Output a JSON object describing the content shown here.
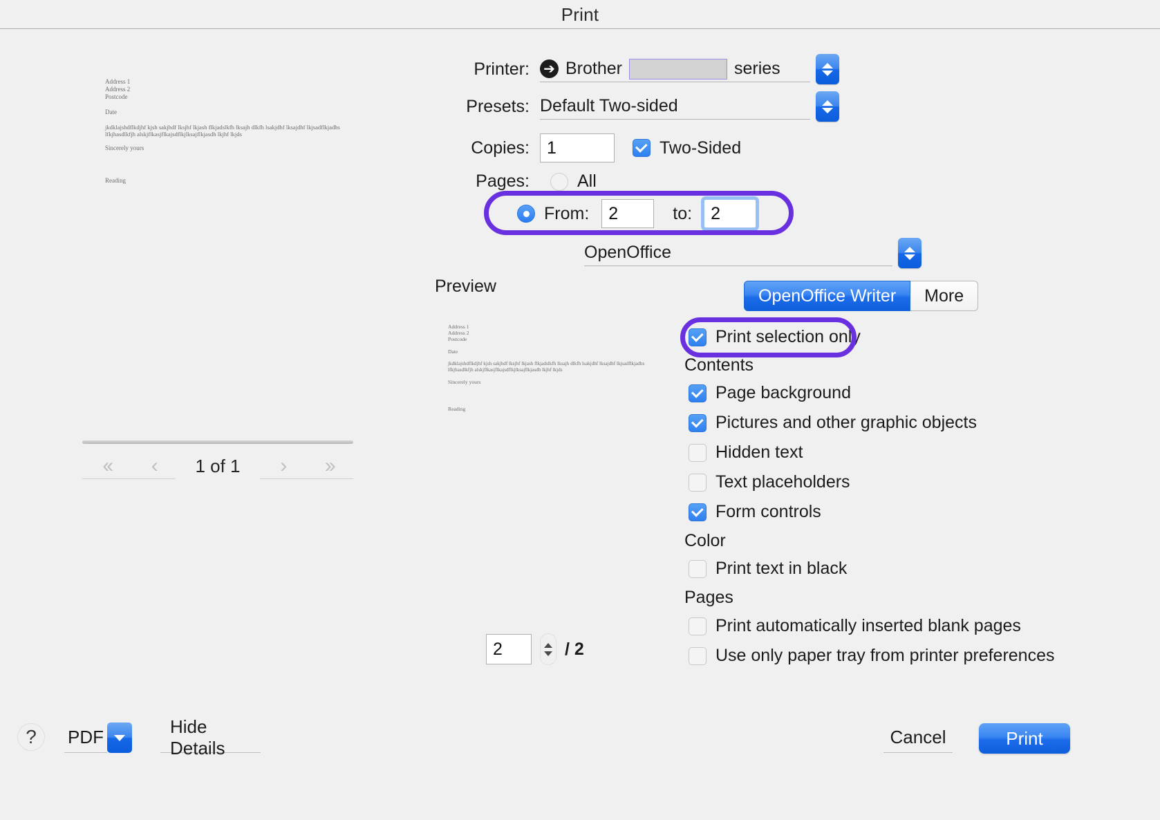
{
  "window": {
    "title": "Print"
  },
  "printer": {
    "label": "Printer:",
    "icon": "brother-status-icon",
    "name_prefix": "Brother",
    "name_suffix": "series",
    "redacted": ""
  },
  "presets": {
    "label": "Presets:",
    "value": "Default Two-sided"
  },
  "copies": {
    "label": "Copies:",
    "value": "1",
    "two_sided_label": "Two-Sided",
    "two_sided_checked": true
  },
  "pages": {
    "label": "Pages:",
    "all_label": "All",
    "all_selected": false,
    "range_selected": true,
    "from_label": "From:",
    "from_value": "2",
    "to_label": "to:",
    "to_value": "2"
  },
  "app_select": {
    "value": "OpenOffice"
  },
  "preview": {
    "label": "Preview",
    "pager_count": "1 of 1",
    "first_icon": "double-chevron-left-icon",
    "prev_icon": "chevron-left-icon",
    "next_icon": "chevron-right-icon",
    "last_icon": "double-chevron-right-icon"
  },
  "document": {
    "lines": [
      "Address 1",
      "Address 2",
      "Postcode",
      "Date",
      "jkdklajshdflkdjhf kjsh sakjhdf lksjhf lkjash flkjadslkfh lksajh dlkfh lsakjdhf lksajdhf lkjsadflkjadhs",
      "lfkjhasdlkfjh alskjflkasjflkajsdflkjlksajflkjasdh lkjhf lkjds",
      "Sincerely yours",
      "Reading"
    ]
  },
  "tabs": [
    {
      "label": "OpenOffice Writer",
      "active": true
    },
    {
      "label": "More",
      "active": false
    }
  ],
  "options": {
    "print_selection_only": {
      "label": "Print selection only",
      "checked": true
    },
    "groups": [
      {
        "heading": "Contents",
        "items": [
          {
            "label": "Page background",
            "checked": true
          },
          {
            "label": "Pictures and other graphic objects",
            "checked": true
          },
          {
            "label": "Hidden text",
            "checked": false
          },
          {
            "label": "Text placeholders",
            "checked": false
          },
          {
            "label": "Form controls",
            "checked": true
          }
        ]
      },
      {
        "heading": "Color",
        "items": [
          {
            "label": "Print text in black",
            "checked": false
          }
        ]
      },
      {
        "heading": "Pages",
        "items": [
          {
            "label": "Print automatically inserted blank pages",
            "checked": false
          },
          {
            "label": "Use only paper tray from printer preferences",
            "checked": false
          }
        ]
      }
    ]
  },
  "page_stepper": {
    "value": "2",
    "total": "/ 2"
  },
  "bottom_bar": {
    "help_label": "?",
    "pdf_label": "PDF",
    "hide_details_label": "Hide Details",
    "cancel_label": "Cancel",
    "print_label": "Print"
  },
  "colors": {
    "accent_blue": "#2f80f0",
    "annotation_purple": "#6930e0",
    "background": "#f0f0f0"
  }
}
